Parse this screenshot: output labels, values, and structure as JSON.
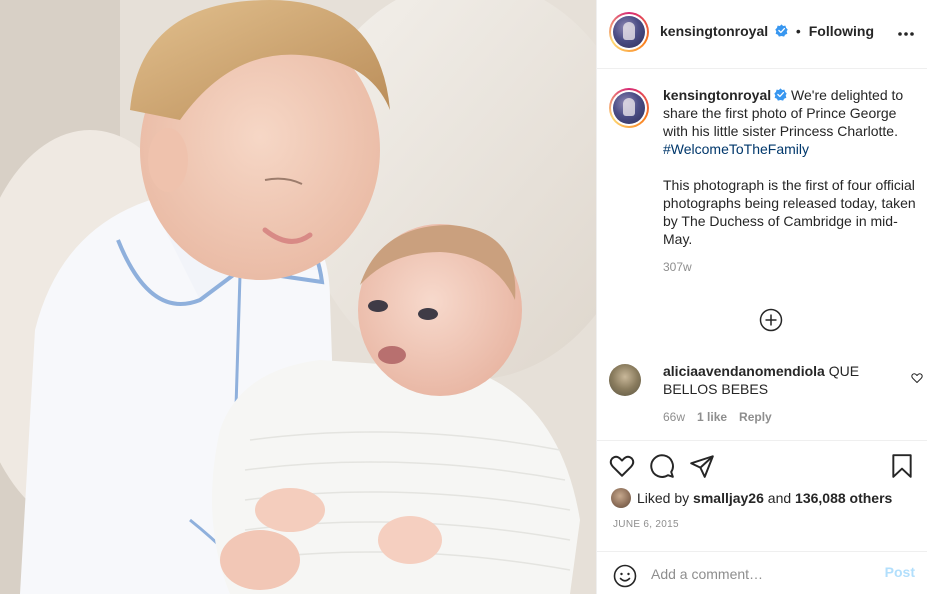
{
  "header": {
    "username": "kensingtonroyal",
    "separator": "•",
    "follow_status": "Following"
  },
  "caption": {
    "username": "kensingtonroyal",
    "text_1": "We're delighted to share the first photo of Prince George with his little sister Princess Charlotte.",
    "hashtag": "#WelcomeToTheFamily",
    "text_2": "This photograph is the first of four official photographs being released today, taken by The Duchess of Cambridge in mid-May.",
    "time": "307w"
  },
  "comments": [
    {
      "username": "aliciaavendanomendiola",
      "text": "QUE BELLOS BEBES",
      "time": "66w",
      "likes": "1 like",
      "reply": "Reply"
    }
  ],
  "likes": {
    "prefix": "Liked by",
    "first_user": "smalljay26",
    "conjunction": "and",
    "others": "136,088 others"
  },
  "date": "June 6, 2015",
  "add_comment": {
    "placeholder": "Add a comment…",
    "post_label": "Post"
  },
  "icons": {
    "verified": "verified-badge-icon",
    "more": "more-options-icon",
    "load_more": "plus-circle-icon",
    "like": "heart-icon",
    "comment": "comment-bubble-icon",
    "share": "paper-plane-icon",
    "save": "bookmark-icon",
    "emoji": "smiley-icon"
  },
  "colors": {
    "verified_blue": "#3897f0",
    "hashtag": "#00376b",
    "muted": "#8e8e8e",
    "post_disabled": "#b2dffc"
  }
}
